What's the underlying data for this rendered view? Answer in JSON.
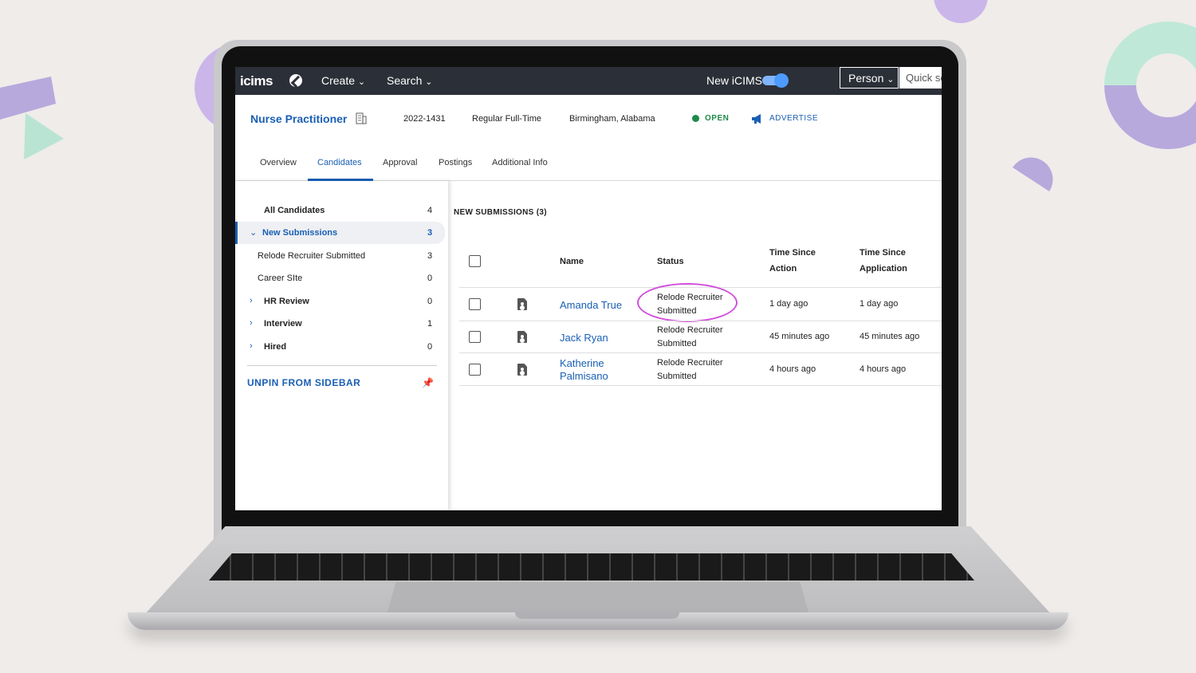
{
  "app": {
    "logo": "icims",
    "nav": {
      "create": "Create",
      "search": "Search",
      "new_icims": "New iCIMS",
      "person": "Person",
      "quick_search_placeholder": "Quick se"
    }
  },
  "job": {
    "title": "Nurse Practitioner",
    "req_id": "2022-1431",
    "type": "Regular Full-Time",
    "location": "Birmingham, Alabama",
    "status": "OPEN",
    "advertise": "ADVERTISE"
  },
  "tabs": [
    "Overview",
    "Candidates",
    "Approval",
    "Postings",
    "Additional Info"
  ],
  "active_tab": "Candidates",
  "sidebar": {
    "items": [
      {
        "label": "All Candidates",
        "count": "4"
      },
      {
        "label": "New Submissions",
        "count": "3"
      },
      {
        "label": "Relode Recruiter Submitted",
        "count": "3"
      },
      {
        "label": "Career SIte",
        "count": "0"
      },
      {
        "label": "HR Review",
        "count": "0"
      },
      {
        "label": "Interview",
        "count": "1"
      },
      {
        "label": "Hired",
        "count": "0"
      }
    ],
    "unpin": "UNPIN FROM SIDEBAR"
  },
  "table": {
    "section_title": "NEW SUBMISSIONS (3)",
    "headers": {
      "name": "Name",
      "status": "Status",
      "tsa_1": "Time Since",
      "tsa_2": "Action",
      "tsap_1": "Time Since",
      "tsap_2": "Application"
    },
    "rows": [
      {
        "name_1": "Amanda True",
        "name_2": "",
        "status_1": "Relode Recruiter",
        "status_2": "Submitted",
        "action": "1 day ago",
        "application": "1 day ago"
      },
      {
        "name_1": "Jack Ryan",
        "name_2": "",
        "status_1": "Relode Recruiter",
        "status_2": "Submitted",
        "action": "45 minutes ago",
        "application": "45 minutes ago"
      },
      {
        "name_1": "Katherine",
        "name_2": "Palmisano",
        "status_1": "Relode Recruiter",
        "status_2": "Submitted",
        "action": "4 hours ago",
        "application": "4 hours ago"
      }
    ]
  },
  "colors": {
    "accent": "#1a5fb4",
    "topbar": "#2b3038",
    "open": "#1e8a4a",
    "highlight": "#d24fdc"
  }
}
